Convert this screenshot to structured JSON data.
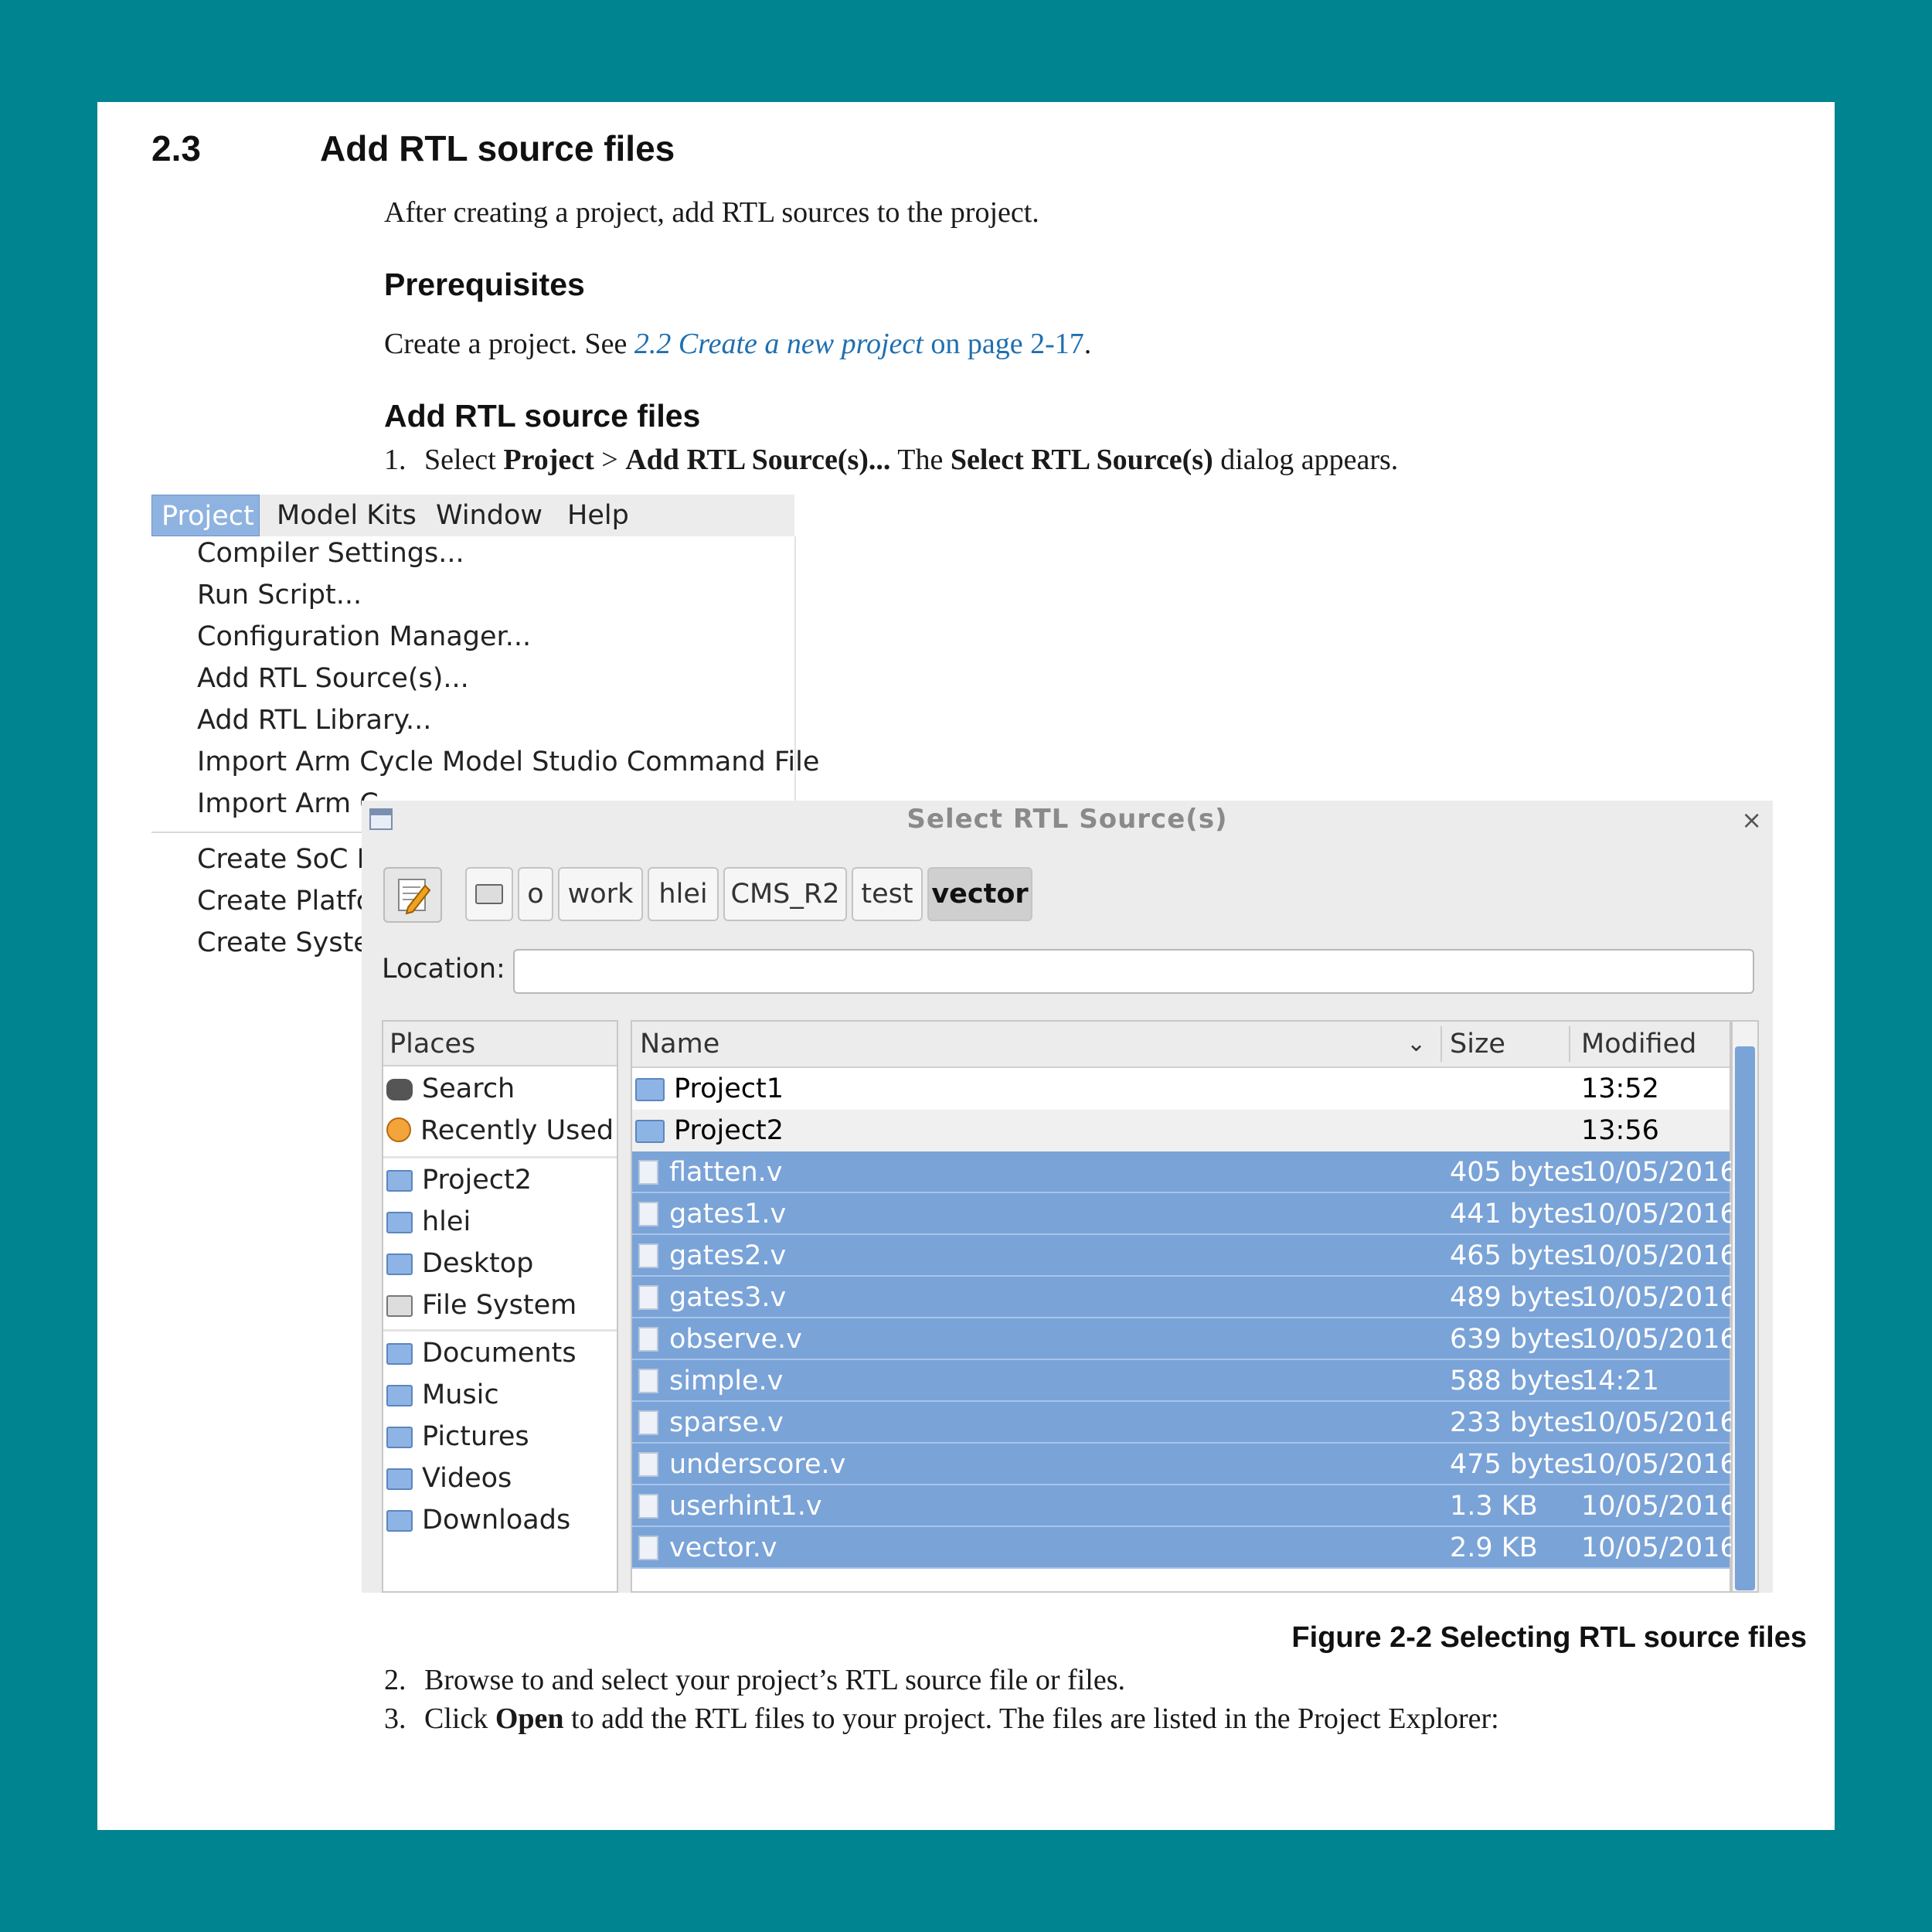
{
  "section": {
    "number": "2.3",
    "title": "Add RTL source files"
  },
  "intro": "After creating a project, add RTL sources to the project.",
  "prereq": {
    "heading": "Prerequisites",
    "text_before": "Create a project. See ",
    "link_italic": "2.2 Create a new project",
    "link_plain": " on page 2-17",
    "text_after": "."
  },
  "steps_heading": "Add RTL source files",
  "step1": {
    "num": "1.",
    "t1": "Select ",
    "b1": "Project",
    "t2": " > ",
    "b2": "Add RTL Source(s)...",
    "t3": " The ",
    "b3": "Select RTL Source(s)",
    "t4": " dialog appears."
  },
  "menubar": {
    "items": [
      "Project",
      "Model Kits",
      "Window",
      "Help"
    ]
  },
  "menu": {
    "items": [
      "Compiler Settings...",
      "Run Script...",
      "Configuration Manager...",
      "Add RTL Source(s)...",
      "Add RTL Library...",
      "Import Arm Cycle Model Studio Command File",
      "Import Arm C"
    ],
    "items2": [
      "Create SoC D",
      "Create Platfor",
      "Create Syster"
    ]
  },
  "dialog": {
    "title": "Select RTL Source(s)",
    "close": "×",
    "breadcrumbs": [
      "o",
      "work",
      "hlei",
      "CMS_R2",
      "test",
      "vector"
    ],
    "location_label": "Location:",
    "location_value": "",
    "places_header": "Places",
    "places": [
      "Search",
      "Recently Used",
      "Project2",
      "hlei",
      "Desktop",
      "File System",
      "Documents",
      "Music",
      "Pictures",
      "Videos",
      "Downloads"
    ],
    "columns": {
      "name": "Name",
      "size": "Size",
      "modified": "Modified"
    },
    "files": [
      {
        "name": "Project1",
        "size": "",
        "modified": "13:52"
      },
      {
        "name": "Project2",
        "size": "",
        "modified": "13:56"
      },
      {
        "name": "flatten.v",
        "size": "405 bytes",
        "modified": "10/05/2016"
      },
      {
        "name": "gates1.v",
        "size": "441 bytes",
        "modified": "10/05/2016"
      },
      {
        "name": "gates2.v",
        "size": "465 bytes",
        "modified": "10/05/2016"
      },
      {
        "name": "gates3.v",
        "size": "489 bytes",
        "modified": "10/05/2016"
      },
      {
        "name": "observe.v",
        "size": "639 bytes",
        "modified": "10/05/2016"
      },
      {
        "name": "simple.v",
        "size": "588 bytes",
        "modified": "14:21"
      },
      {
        "name": "sparse.v",
        "size": "233 bytes",
        "modified": "10/05/2016"
      },
      {
        "name": "underscore.v",
        "size": "475 bytes",
        "modified": "10/05/2016"
      },
      {
        "name": "userhint1.v",
        "size": "1.3 KB",
        "modified": "10/05/2016"
      },
      {
        "name": "vector.v",
        "size": "2.9 KB",
        "modified": "10/05/2016"
      }
    ]
  },
  "caption": "Figure 2-2  Selecting RTL source files",
  "step2": {
    "num": "2.",
    "text": "Browse to and select your project’s RTL source file or files."
  },
  "step3": {
    "num": "3.",
    "t1": "Click ",
    "b1": "Open",
    "t2": " to add the RTL files to your project. The files are listed in the Project Explorer:"
  },
  "colors": {
    "background": "#008490",
    "selection": "#7aa3d8",
    "link": "#1f6fb0"
  }
}
